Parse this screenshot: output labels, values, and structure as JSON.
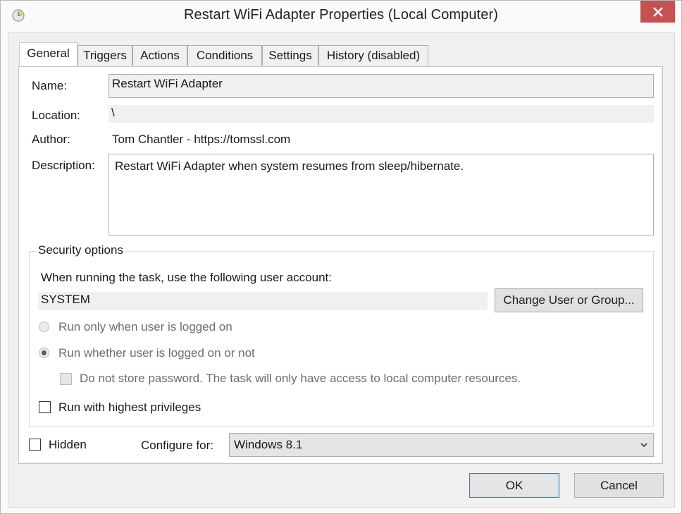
{
  "window": {
    "title": "Restart WiFi Adapter Properties (Local Computer)",
    "icon": "task-scheduler-clock-icon",
    "close_icon": "close-icon",
    "close_color": "#c75050"
  },
  "tabs": [
    {
      "label": "General",
      "active": true
    },
    {
      "label": "Triggers",
      "active": false
    },
    {
      "label": "Actions",
      "active": false
    },
    {
      "label": "Conditions",
      "active": false
    },
    {
      "label": "Settings",
      "active": false
    },
    {
      "label": "History (disabled)",
      "active": false
    }
  ],
  "general": {
    "name_label": "Name:",
    "name_value": "Restart WiFi Adapter",
    "location_label": "Location:",
    "location_value": "\\",
    "author_label": "Author:",
    "author_value": "Tom Chantler - https://tomssl.com",
    "description_label": "Description:",
    "description_value": "Restart WiFi Adapter when system resumes from sleep/hibernate."
  },
  "security": {
    "legend": "Security options",
    "account_prompt": "When running the task, use the following user account:",
    "account_value": "SYSTEM",
    "change_button": "Change User or Group...",
    "radio_logged_on": {
      "label": "Run only when user is logged on",
      "selected": false,
      "enabled": false
    },
    "radio_whether": {
      "label": "Run whether user is logged on or not",
      "selected": true,
      "enabled": false
    },
    "no_store_password": {
      "label": "Do not store password.  The task will only have access to local computer resources.",
      "checked": false,
      "enabled": false
    },
    "highest_privileges": {
      "label": "Run with highest privileges",
      "checked": false
    }
  },
  "footer_options": {
    "hidden_label": "Hidden",
    "hidden_checked": false,
    "configure_label": "Configure for:",
    "configure_value": "Windows 8.1"
  },
  "buttons": {
    "ok": "OK",
    "cancel": "Cancel"
  }
}
